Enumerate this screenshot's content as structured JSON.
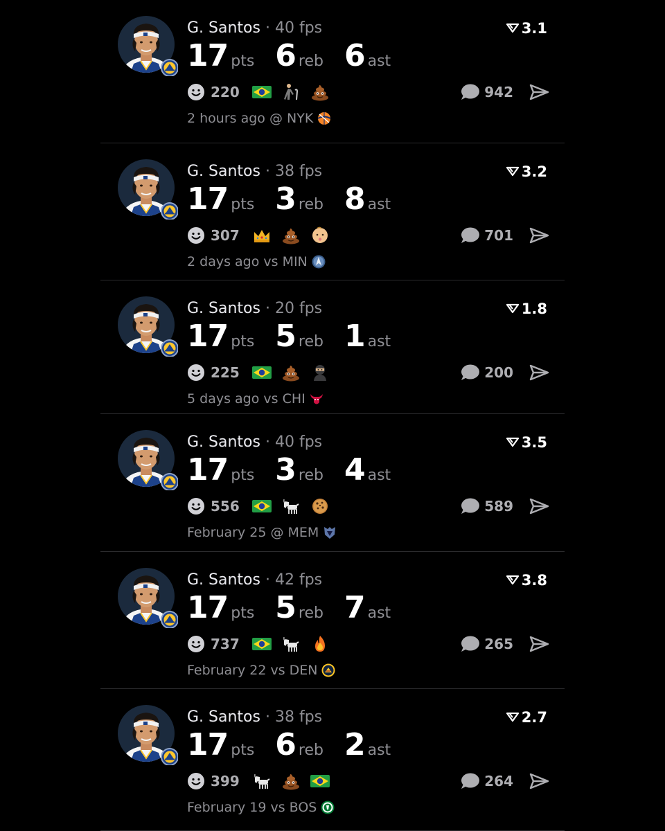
{
  "posts": [
    {
      "player": "G. Santos",
      "separator": "·",
      "fps": "40 fps",
      "score": "3.1",
      "pts": "17",
      "pts_label": "pts",
      "reb": "6",
      "reb_label": "reb",
      "ast": "6",
      "ast_label": "ast",
      "reaction_count": "220",
      "reactions": [
        "brazil-flag-emoji",
        "old-man-cane-emoji",
        "poop-emoji"
      ],
      "comment_count": "942",
      "time": "2 hours ago @ NYK",
      "team_logo": "knicks-logo"
    },
    {
      "player": "G. Santos",
      "separator": "·",
      "fps": "38 fps",
      "score": "3.2",
      "pts": "17",
      "pts_label": "pts",
      "reb": "3",
      "reb_label": "reb",
      "ast": "8",
      "ast_label": "ast",
      "reaction_count": "307",
      "reactions": [
        "crown-emoji",
        "poop-emoji",
        "baby-emoji"
      ],
      "comment_count": "701",
      "time": "2 days ago vs MIN",
      "team_logo": "timberwolves-logo"
    },
    {
      "player": "G. Santos",
      "separator": "·",
      "fps": "20 fps",
      "score": "1.8",
      "pts": "17",
      "pts_label": "pts",
      "reb": "5",
      "reb_label": "reb",
      "ast": "1",
      "ast_label": "ast",
      "reaction_count": "225",
      "reactions": [
        "brazil-flag-emoji",
        "poop-emoji",
        "ninja-emoji"
      ],
      "comment_count": "200",
      "time": "5 days ago vs CHI",
      "team_logo": "bulls-logo"
    },
    {
      "player": "G. Santos",
      "separator": "·",
      "fps": "40 fps",
      "score": "3.5",
      "pts": "17",
      "pts_label": "pts",
      "reb": "3",
      "reb_label": "reb",
      "ast": "4",
      "ast_label": "ast",
      "reaction_count": "556",
      "reactions": [
        "brazil-flag-emoji",
        "goat-emoji",
        "cookie-emoji"
      ],
      "comment_count": "589",
      "time": "February 25 @ MEM",
      "team_logo": "grizzlies-logo"
    },
    {
      "player": "G. Santos",
      "separator": "·",
      "fps": "42 fps",
      "score": "3.8",
      "pts": "17",
      "pts_label": "pts",
      "reb": "5",
      "reb_label": "reb",
      "ast": "7",
      "ast_label": "ast",
      "reaction_count": "737",
      "reactions": [
        "brazil-flag-emoji",
        "goat-emoji",
        "fire-emoji"
      ],
      "comment_count": "265",
      "time": "February 22 vs DEN",
      "team_logo": "nuggets-logo"
    },
    {
      "player": "G. Santos",
      "separator": "·",
      "fps": "38 fps",
      "score": "2.7",
      "pts": "17",
      "pts_label": "pts",
      "reb": "6",
      "reb_label": "reb",
      "ast": "2",
      "ast_label": "ast",
      "reaction_count": "399",
      "reactions": [
        "goat-emoji",
        "poop-emoji",
        "brazil-flag-emoji"
      ],
      "comment_count": "264",
      "time": "February 19 vs BOS",
      "team_logo": "celtics-logo"
    }
  ],
  "colors": {
    "background": "#000000",
    "text_primary": "#ffffff",
    "text_secondary": "#8e8e93",
    "divider": "#2c2c2e",
    "warriors_blue": "#1d428a",
    "warriors_gold": "#ffc72c"
  }
}
